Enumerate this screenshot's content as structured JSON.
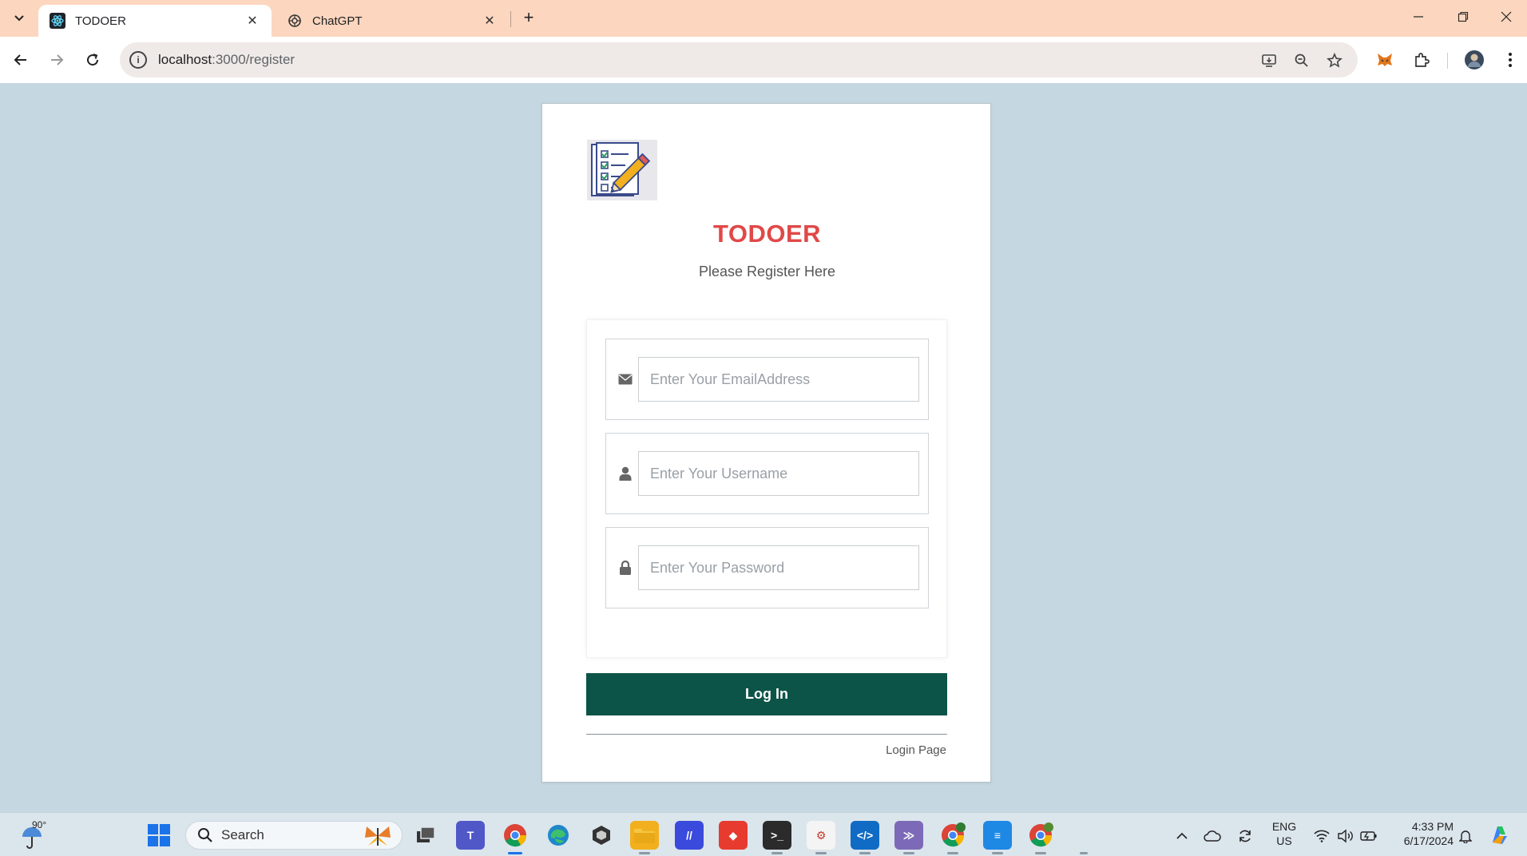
{
  "browser": {
    "tabs": [
      {
        "title": "TODOER",
        "active": true,
        "icon": "react-icon"
      },
      {
        "title": "ChatGPT",
        "active": false,
        "icon": "chatgpt-icon"
      }
    ],
    "url_host": "localhost",
    "url_path": ":3000/register"
  },
  "page": {
    "brand": "TODOER",
    "subtitle": "Please Register Here",
    "email_placeholder": "Enter Your EmailAddress",
    "username_placeholder": "Enter Your Username",
    "password_placeholder": "Enter Your Password",
    "submit_label": "Log In",
    "login_link": "Login Page",
    "colors": {
      "brand": "#e04848",
      "button": "#0c5448",
      "background": "#c5d8e2"
    }
  },
  "taskbar": {
    "weather_temp": "90°",
    "search_label": "Search",
    "lang_line1": "ENG",
    "lang_line2": "US",
    "time": "4:33 PM",
    "date": "6/17/2024"
  }
}
